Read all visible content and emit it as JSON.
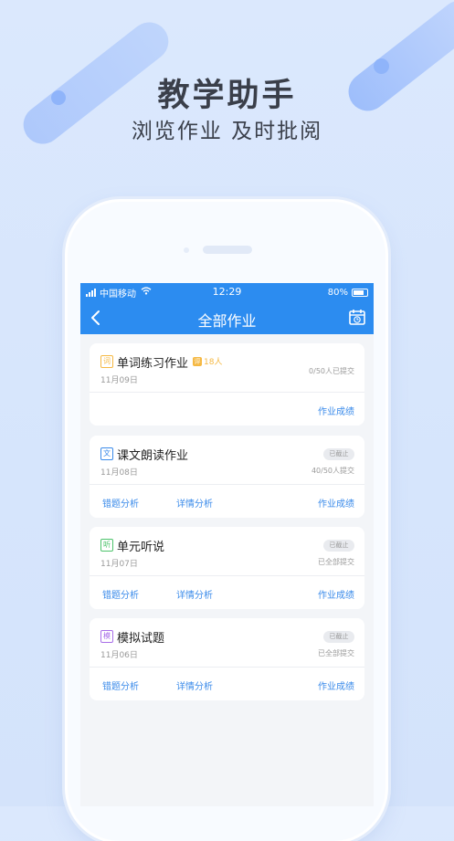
{
  "promo": {
    "title": "教学助手",
    "subtitle": "浏览作业  及时批阅"
  },
  "status_bar": {
    "carrier": "中国移动",
    "time": "12:29",
    "battery": "80%"
  },
  "nav": {
    "title": "全部作业",
    "back_icon": "chevron-left-icon",
    "calendar_icon": "calendar-clock-icon"
  },
  "colors": {
    "primary": "#2c8cf0",
    "link": "#3b8bea",
    "badge": "#f5b842",
    "background": "#dbe8fd"
  },
  "assignments": [
    {
      "tag": "词",
      "tag_color": "#f5b842",
      "title": "单词练习作业",
      "badge_icon": "评",
      "badge_text": "18人",
      "date": "11月09日",
      "submission": "0/50人已提交",
      "links": {
        "grades": "作业成绩"
      }
    },
    {
      "tag": "文",
      "tag_color": "#3b8bea",
      "title": "课文朗读作业",
      "closed": "已截止",
      "date": "11月08日",
      "submission": "40/50人提交",
      "links": {
        "errors": "错题分析",
        "details": "详情分析",
        "grades": "作业成绩"
      }
    },
    {
      "tag": "听",
      "tag_color": "#4cc36b",
      "title": "单元听说",
      "closed": "已截止",
      "date": "11月07日",
      "submission": "已全部提交",
      "links": {
        "errors": "错题分析",
        "details": "详情分析",
        "grades": "作业成绩"
      }
    },
    {
      "tag": "模",
      "tag_color": "#a86ee8",
      "title": "模拟试题",
      "closed": "已截止",
      "date": "11月06日",
      "submission": "已全部提交",
      "links": {
        "errors": "错题分析",
        "details": "详情分析",
        "grades": "作业成绩"
      }
    }
  ]
}
